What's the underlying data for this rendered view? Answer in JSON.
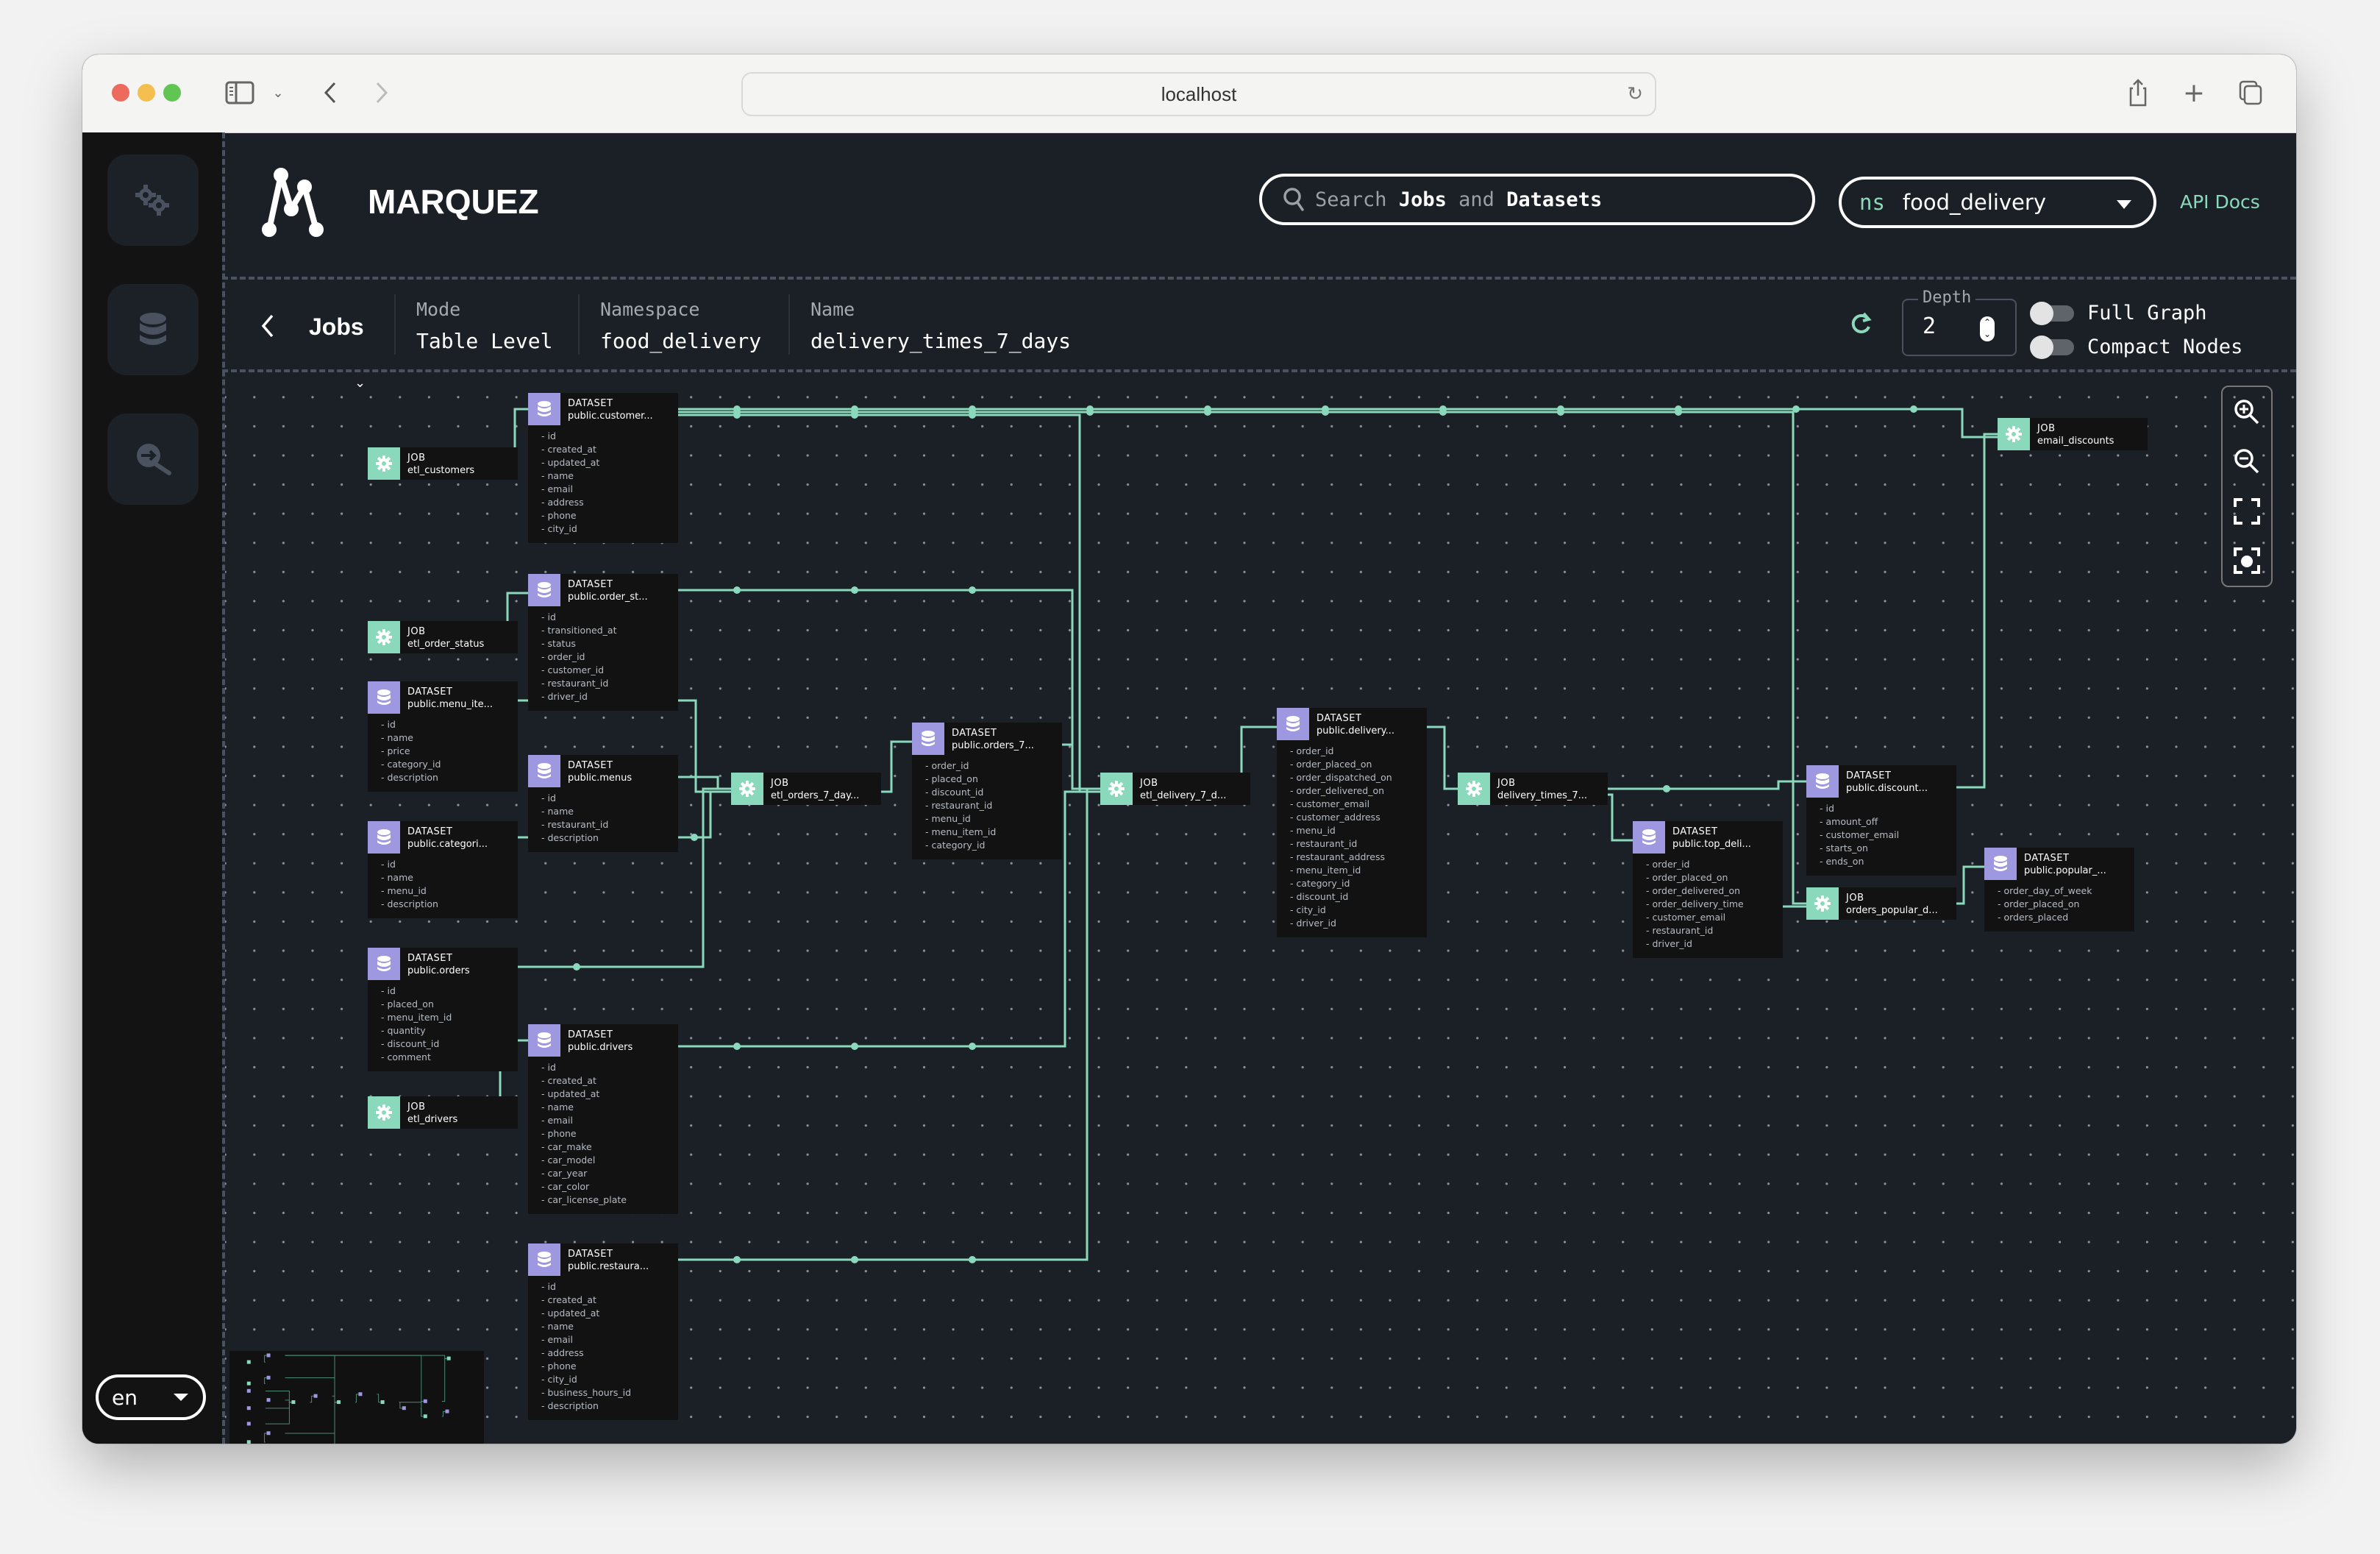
{
  "browser": {
    "url": "localhost",
    "icons": [
      "sidebar-toggle-icon",
      "chevron-down-icon",
      "back-icon",
      "forward-icon",
      "reload-icon",
      "share-icon",
      "new-tab-icon",
      "tabs-overview-icon"
    ]
  },
  "sidebar": {
    "items": [
      {
        "name": "jobs",
        "icon": "gears-icon"
      },
      {
        "name": "datasets",
        "icon": "database-icon"
      },
      {
        "name": "lineage",
        "icon": "search-arrow-icon"
      }
    ],
    "language": "en"
  },
  "header": {
    "brand": "MARQUEZ",
    "search": {
      "prefix": "Search",
      "jobs": "Jobs",
      "and": "and",
      "datasets": "Datasets"
    },
    "namespace_label": "ns",
    "namespace_value": "food_delivery",
    "api_docs": "API Docs"
  },
  "toolbar": {
    "back_label": "Jobs",
    "mode_label": "Mode",
    "mode_value": "Table Level",
    "namespace_label": "Namespace",
    "namespace_value": "food_delivery",
    "name_label": "Name",
    "name_value": "delivery_times_7_days",
    "depth_label": "Depth",
    "depth_value": "2",
    "full_graph_label": "Full Graph",
    "full_graph_on": false,
    "compact_nodes_label": "Compact Nodes",
    "compact_nodes_on": false
  },
  "colors": {
    "accent": "#8bd9bc",
    "dataset": "#9d98e0",
    "background": "#1b1f26",
    "node_bg": "#121212"
  },
  "graph": {
    "nodes": [
      {
        "id": "j_etl_customers",
        "kind": "job",
        "type": "JOB",
        "name": "etl_customers",
        "fields": []
      },
      {
        "id": "d_customers",
        "kind": "dataset",
        "type": "DATASET",
        "name": "public.customer...",
        "fields": [
          "id",
          "created_at",
          "updated_at",
          "name",
          "email",
          "address",
          "phone",
          "city_id"
        ]
      },
      {
        "id": "j_etl_order_status",
        "kind": "job",
        "type": "JOB",
        "name": "etl_order_status",
        "fields": []
      },
      {
        "id": "d_order_status",
        "kind": "dataset",
        "type": "DATASET",
        "name": "public.order_st...",
        "fields": [
          "id",
          "transitioned_at",
          "status",
          "order_id",
          "customer_id",
          "restaurant_id",
          "driver_id"
        ]
      },
      {
        "id": "d_menu_items",
        "kind": "dataset",
        "type": "DATASET",
        "name": "public.menu_ite...",
        "fields": [
          "id",
          "name",
          "price",
          "category_id",
          "description"
        ]
      },
      {
        "id": "d_menus",
        "kind": "dataset",
        "type": "DATASET",
        "name": "public.menus",
        "fields": [
          "id",
          "name",
          "restaurant_id",
          "description"
        ]
      },
      {
        "id": "d_categories",
        "kind": "dataset",
        "type": "DATASET",
        "name": "public.categori...",
        "fields": [
          "id",
          "name",
          "menu_id",
          "description"
        ]
      },
      {
        "id": "d_orders",
        "kind": "dataset",
        "type": "DATASET",
        "name": "public.orders",
        "fields": [
          "id",
          "placed_on",
          "menu_item_id",
          "quantity",
          "discount_id",
          "comment"
        ]
      },
      {
        "id": "d_drivers",
        "kind": "dataset",
        "type": "DATASET",
        "name": "public.drivers",
        "fields": [
          "id",
          "created_at",
          "updated_at",
          "name",
          "email",
          "phone",
          "car_make",
          "car_model",
          "car_year",
          "car_color",
          "car_license_plate"
        ]
      },
      {
        "id": "j_etl_drivers",
        "kind": "job",
        "type": "JOB",
        "name": "etl_drivers",
        "fields": []
      },
      {
        "id": "d_restaurants",
        "kind": "dataset",
        "type": "DATASET",
        "name": "public.restaura...",
        "fields": [
          "id",
          "created_at",
          "updated_at",
          "name",
          "email",
          "address",
          "phone",
          "city_id",
          "business_hours_id",
          "description"
        ]
      },
      {
        "id": "j_etl_orders_7",
        "kind": "job",
        "type": "JOB",
        "name": "etl_orders_7_day...",
        "fields": []
      },
      {
        "id": "d_orders_7",
        "kind": "dataset",
        "type": "DATASET",
        "name": "public.orders_7...",
        "fields": [
          "order_id",
          "placed_on",
          "discount_id",
          "restaurant_id",
          "menu_id",
          "menu_item_id",
          "category_id"
        ]
      },
      {
        "id": "j_etl_delivery_7",
        "kind": "job",
        "type": "JOB",
        "name": "etl_delivery_7_d...",
        "fields": []
      },
      {
        "id": "d_delivery",
        "kind": "dataset",
        "type": "DATASET",
        "name": "public.delivery...",
        "fields": [
          "order_id",
          "order_placed_on",
          "order_dispatched_on",
          "order_delivered_on",
          "customer_email",
          "customer_address",
          "menu_id",
          "restaurant_id",
          "restaurant_address",
          "menu_item_id",
          "category_id",
          "discount_id",
          "city_id",
          "driver_id"
        ]
      },
      {
        "id": "j_delivery_times_7",
        "kind": "job",
        "type": "JOB",
        "name": "delivery_times_7...",
        "fields": []
      },
      {
        "id": "d_top_delivery",
        "kind": "dataset",
        "type": "DATASET",
        "name": "public.top_deli...",
        "fields": [
          "order_id",
          "order_placed_on",
          "order_delivered_on",
          "order_delivery_time",
          "customer_email",
          "restaurant_id",
          "driver_id"
        ]
      },
      {
        "id": "d_discounts",
        "kind": "dataset",
        "type": "DATASET",
        "name": "public.discount...",
        "fields": [
          "id",
          "amount_off",
          "customer_email",
          "starts_on",
          "ends_on"
        ]
      },
      {
        "id": "j_orders_popular",
        "kind": "job",
        "type": "JOB",
        "name": "orders_popular_d...",
        "fields": []
      },
      {
        "id": "d_popular",
        "kind": "dataset",
        "type": "DATASET",
        "name": "public.popular_...",
        "fields": [
          "order_day_of_week",
          "order_placed_on",
          "orders_placed"
        ]
      },
      {
        "id": "j_email_discounts",
        "kind": "job",
        "type": "JOB",
        "name": "email_discounts",
        "fields": []
      }
    ],
    "edges": [
      [
        "j_etl_customers",
        "d_customers"
      ],
      [
        "j_etl_order_status",
        "d_order_status"
      ],
      [
        "j_etl_drivers",
        "d_drivers"
      ],
      [
        "d_customers",
        "j_email_discounts"
      ],
      [
        "d_customers",
        "j_orders_popular"
      ],
      [
        "d_customers",
        "j_etl_delivery_7"
      ],
      [
        "d_order_status",
        "j_etl_delivery_7"
      ],
      [
        "d_menu_items",
        "j_etl_orders_7"
      ],
      [
        "d_menus",
        "j_etl_orders_7"
      ],
      [
        "d_categories",
        "j_etl_orders_7"
      ],
      [
        "d_orders",
        "j_etl_orders_7"
      ],
      [
        "d_drivers",
        "j_etl_delivery_7"
      ],
      [
        "d_restaurants",
        "j_etl_delivery_7"
      ],
      [
        "j_etl_orders_7",
        "d_orders_7"
      ],
      [
        "d_orders_7",
        "j_etl_delivery_7"
      ],
      [
        "j_etl_delivery_7",
        "d_delivery"
      ],
      [
        "d_delivery",
        "j_delivery_times_7"
      ],
      [
        "j_delivery_times_7",
        "d_top_delivery"
      ],
      [
        "j_delivery_times_7",
        "d_discounts"
      ],
      [
        "d_top_delivery",
        "j_orders_popular"
      ],
      [
        "d_discounts",
        "j_email_discounts"
      ],
      [
        "j_orders_popular",
        "d_popular"
      ]
    ]
  },
  "zoom_controls": [
    "zoom-in-icon",
    "zoom-out-icon",
    "fit-screen-icon",
    "center-focus-icon"
  ]
}
